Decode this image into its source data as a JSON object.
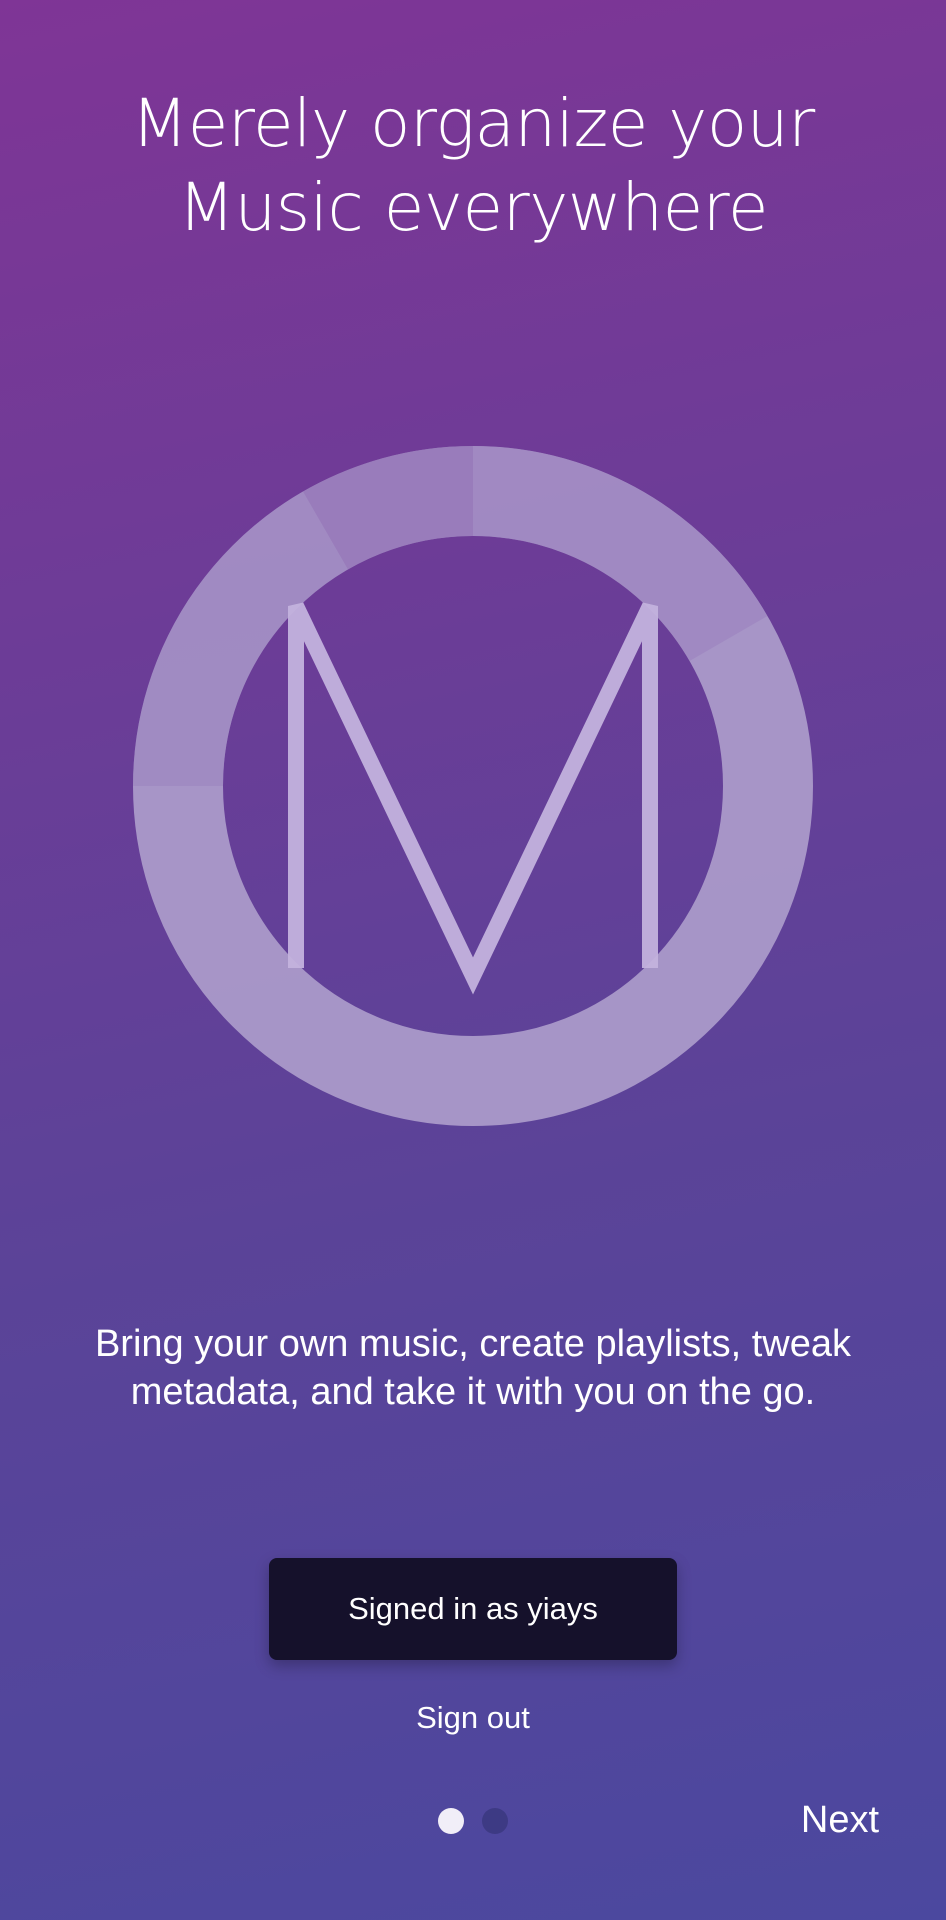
{
  "onboarding": {
    "headline_line1": "Merely organize your",
    "headline_line2": "Music everywhere",
    "logo_icon": "merely-m-logo-icon",
    "description_line1": "Bring your own music, create playlists, tweak",
    "description_line2": "metadata, and take it with you on the go.",
    "signed_in_label": "Signed in as yiays",
    "sign_out_label": "Sign out",
    "next_label": "Next",
    "page_index": 1,
    "page_count": 2
  },
  "colors": {
    "gradient_top": "#7f3596",
    "gradient_bottom": "#4b489f",
    "button_bg": "#15112b",
    "logo_ring": "#ad9ccb",
    "dot_active": "#f1eef8",
    "dot_inactive": "#3d3a84"
  }
}
